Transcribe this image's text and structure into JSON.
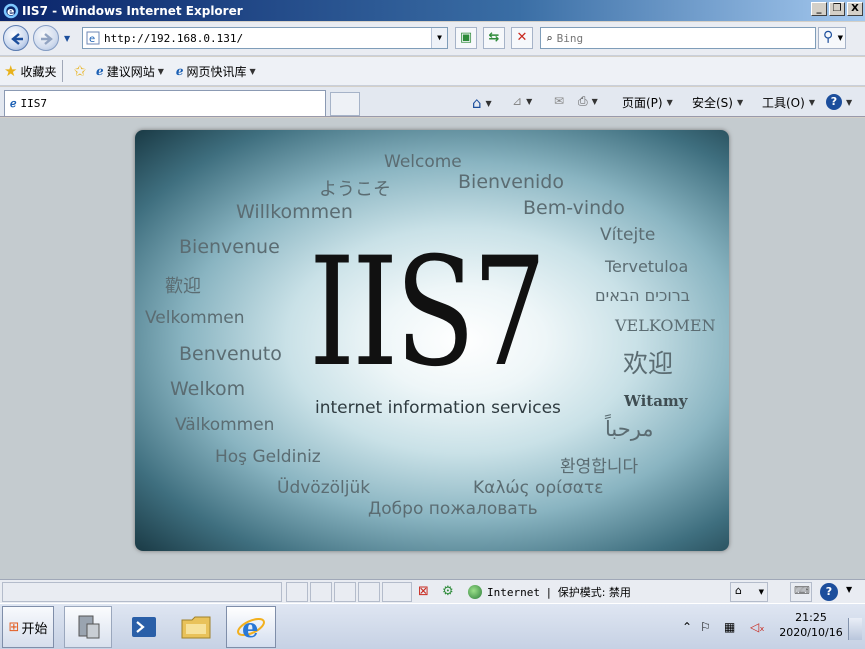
{
  "window": {
    "title": "IIS7 - Windows Internet Explorer",
    "min": "_",
    "restore": "❐",
    "close": "X"
  },
  "nav": {
    "url": "http://192.168.0.131/",
    "search_placeholder": "Bing"
  },
  "favorites": {
    "label": "收藏夹",
    "items": [
      "建议网站",
      "网页快讯库"
    ]
  },
  "tab": {
    "title": "IIS7"
  },
  "commands": {
    "page": "页面(P)",
    "safety": "安全(S)",
    "tools": "工具(O)"
  },
  "poster": {
    "title": "IIS7",
    "subtitle": "internet information services",
    "words": [
      "Welcome",
      "ようこそ",
      "Bienvenido",
      "Willkommen",
      "Bem-vindo",
      "Vítejte",
      "Bienvenue",
      "Tervetuloa",
      "歡迎",
      "ברוכים הבאים",
      "Velkommen",
      "VELKOMEN",
      "Benvenuto",
      "欢迎",
      "Welkom",
      "Witamy",
      "Välkommen",
      "مرحباً",
      "Hoş Geldiniz",
      "환영합니다",
      "Üdvözöljük",
      "Καλώς ορίσατε",
      "Добро пожаловать"
    ]
  },
  "status": {
    "zone": "Internet",
    "protected": "保护模式: 禁用"
  },
  "taskbar": {
    "start": "开始",
    "time": "21:25",
    "date": "2020/10/16"
  }
}
